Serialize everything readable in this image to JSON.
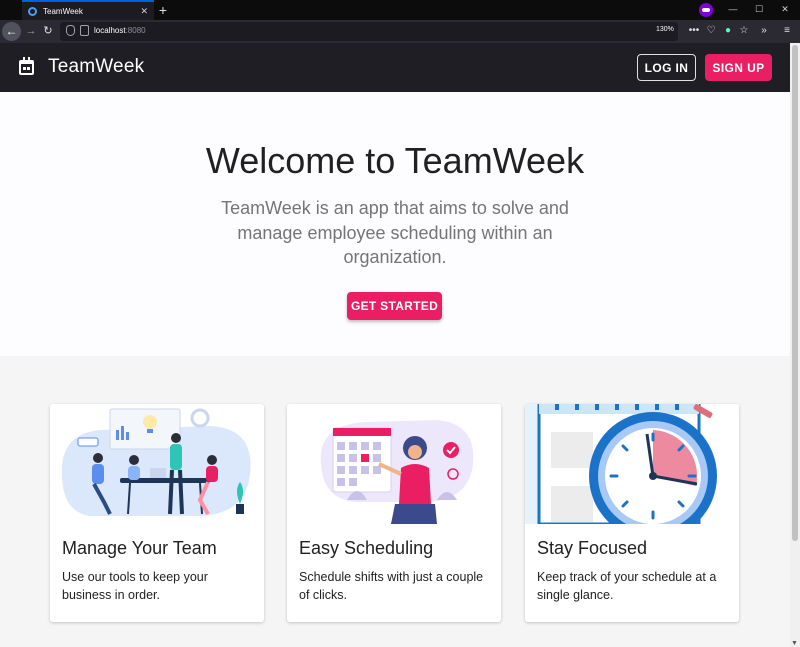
{
  "browser": {
    "tab_title": "TeamWeek",
    "url_host": "localhost",
    "url_port": ":8080",
    "zoom": "130%",
    "icons": [
      "back-icon",
      "forward-icon",
      "reload-icon",
      "shield-icon",
      "page-icon",
      "more-icon",
      "pocket-icon",
      "extension-icon",
      "star-icon",
      "overflow-icon",
      "menu-icon"
    ]
  },
  "appbar": {
    "brand": "TeamWeek",
    "login_label": "LOG IN",
    "signup_label": "SIGN UP"
  },
  "hero": {
    "title": "Welcome to TeamWeek",
    "subtitle": "TeamWeek is an app that aims to solve and manage employee scheduling within an organization.",
    "cta_label": "GET STARTED"
  },
  "cards": [
    {
      "title": "Manage Your Team",
      "text": "Use our tools to keep your business in order."
    },
    {
      "title": "Easy Scheduling",
      "text": "Schedule shifts with just a couple of clicks."
    },
    {
      "title": "Stay Focused",
      "text": "Keep track of your schedule at a single glance."
    }
  ],
  "colors": {
    "accent": "#e91e63",
    "appbar": "#1e1e24",
    "hero_bg": "#fdfcfe",
    "page_bg": "#f5f5f5"
  }
}
